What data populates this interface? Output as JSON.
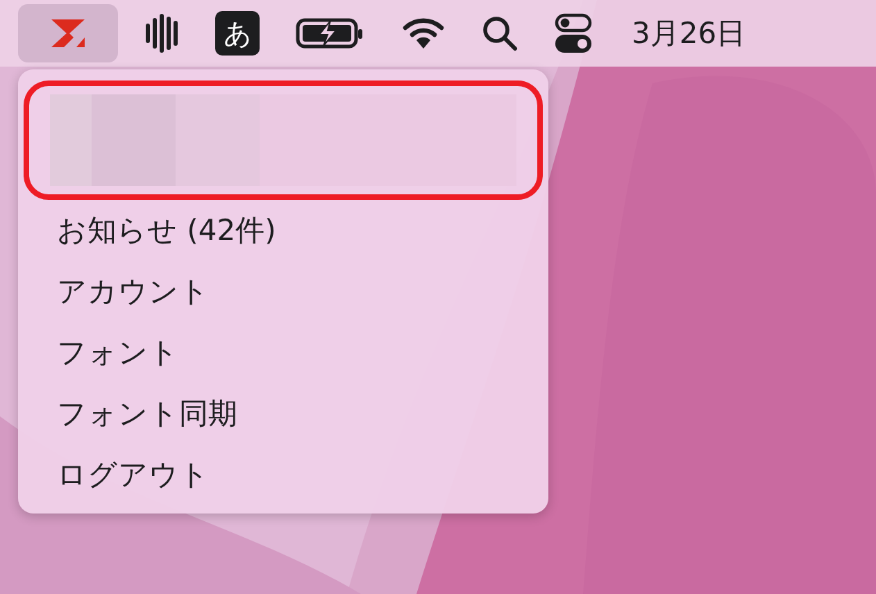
{
  "menu_bar": {
    "input_method": "あ",
    "date": "3月26日"
  },
  "menu": {
    "items": [
      "お知らせ (42件)",
      "アカウント",
      "フォント",
      "フォント同期",
      "ログアウト"
    ]
  }
}
